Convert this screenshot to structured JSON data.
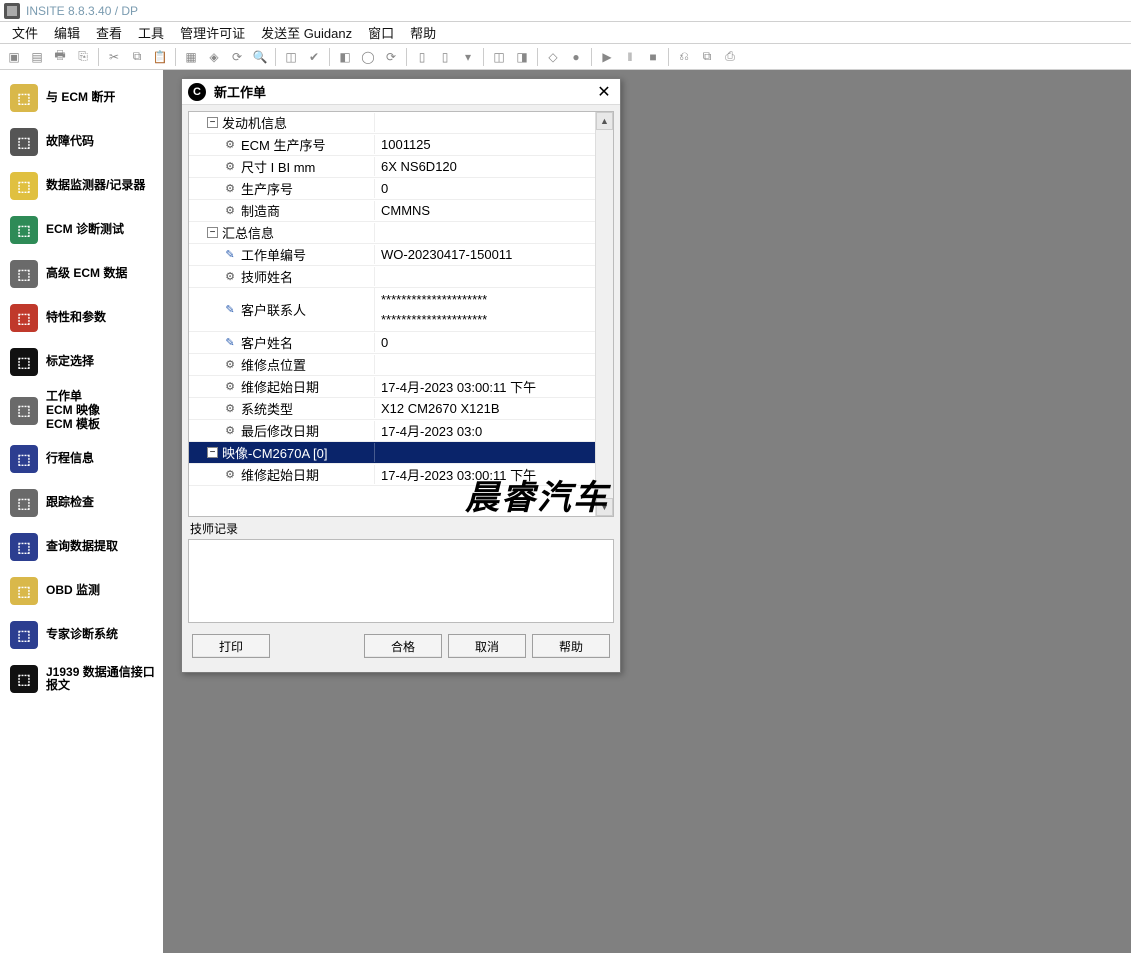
{
  "title": "INSITE 8.8.3.40 / DP",
  "menu": {
    "items": [
      "文件",
      "编辑",
      "查看",
      "工具",
      "管理许可证",
      "发送至 Guidanz",
      "窗口",
      "帮助"
    ]
  },
  "sidebar": {
    "items": [
      {
        "label": "与 ECM 断开",
        "color": "#d9b84a"
      },
      {
        "label": "故障代码",
        "color": "#555"
      },
      {
        "label": "数据监测器/记录器",
        "color": "#e0c040"
      },
      {
        "label": "ECM 诊断测试",
        "color": "#2e8b57"
      },
      {
        "label": "高级 ECM 数据",
        "color": "#6a6a6a"
      },
      {
        "label": "特性和参数",
        "color": "#c0392b"
      },
      {
        "label": "标定选择",
        "color": "#111"
      },
      {
        "label": "工作单\nECM 映像\nECM 模板",
        "color": "#6a6a6a"
      },
      {
        "label": "行程信息",
        "color": "#2c3e90"
      },
      {
        "label": "跟踪检查",
        "color": "#6a6a6a"
      },
      {
        "label": "查询数据提取",
        "color": "#2c3e90"
      },
      {
        "label": "OBD 监测",
        "color": "#d9b84a"
      },
      {
        "label": "专家诊断系统",
        "color": "#2c3e90"
      },
      {
        "label": "J1939 数据通信接口报文",
        "color": "#111"
      }
    ]
  },
  "dialog": {
    "title": "新工作单",
    "note_label": "技师记录",
    "note_value": "",
    "buttons": {
      "print": "打印",
      "ok": "合格",
      "cancel": "取消",
      "help": "帮助"
    },
    "rows": [
      {
        "type": "group",
        "exp": "−",
        "key": "发动机信息",
        "val": "",
        "level": 1
      },
      {
        "type": "item",
        "icon": "gear",
        "key": "ECM 生产序号",
        "val": "1001125",
        "level": 2
      },
      {
        "type": "item",
        "icon": "gear",
        "key": "尺寸 I BI mm",
        "val": "6X NS6D120",
        "level": 2
      },
      {
        "type": "item",
        "icon": "gear",
        "key": "生产序号",
        "val": "0",
        "level": 2
      },
      {
        "type": "item",
        "icon": "gear",
        "key": "制造商",
        "val": "CMMNS",
        "level": 2
      },
      {
        "type": "group",
        "exp": "−",
        "key": "汇总信息",
        "val": "",
        "level": 1
      },
      {
        "type": "item",
        "icon": "pen",
        "key": "工作单编号",
        "val": "WO-20230417-150011",
        "level": 2
      },
      {
        "type": "item",
        "icon": "gear",
        "key": "技师姓名",
        "val": "",
        "level": 2
      },
      {
        "type": "item",
        "icon": "pen",
        "key": "客户联系人",
        "val": "*********************\n*********************",
        "level": 2,
        "two": true
      },
      {
        "type": "item",
        "icon": "pen",
        "key": "客户姓名",
        "val": "0",
        "level": 2
      },
      {
        "type": "item",
        "icon": "gear",
        "key": "维修点位置",
        "val": "",
        "level": 2
      },
      {
        "type": "item",
        "icon": "gear",
        "key": "维修起始日期",
        "val": "17-4月-2023 03:00:11 下午",
        "level": 2
      },
      {
        "type": "item",
        "icon": "gear",
        "key": "系统类型",
        "val": "X12 CM2670 X121B",
        "level": 2
      },
      {
        "type": "item",
        "icon": "gear",
        "key": "最后修改日期",
        "val": "17-4月-2023 03:0",
        "level": 2
      },
      {
        "type": "group",
        "exp": "−",
        "key": "映像-CM2670A [0]",
        "val": "",
        "level": 1,
        "selected": true
      },
      {
        "type": "item",
        "icon": "gear",
        "key": "维修起始日期",
        "val": "17-4月-2023 03:00:11 下午",
        "level": 2
      }
    ]
  },
  "watermark": "晨睿汽车"
}
